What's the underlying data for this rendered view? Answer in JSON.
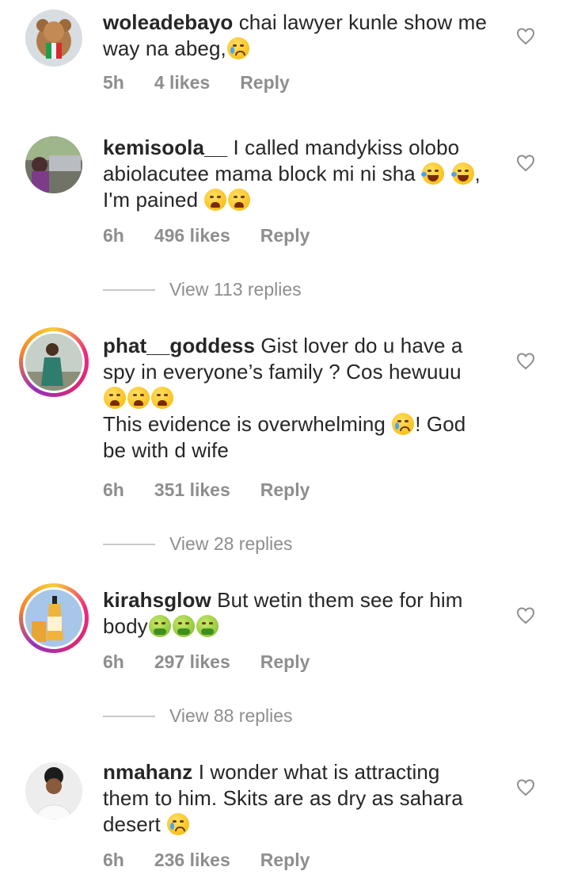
{
  "comments": [
    {
      "username": "woleadebayo",
      "text_parts": [
        "chai lawyer kunle show me way na abeg,"
      ],
      "emoji_end": [
        "crying-face-emoji"
      ],
      "time": "5h",
      "likes": "4 likes",
      "reply": "Reply"
    },
    {
      "username": "kemisoola__",
      "text": "I called mandykiss olobo abiolacutee mama block mi ni sha",
      "text2": ", I'm pained",
      "time": "6h",
      "likes": "496 likes",
      "reply": "Reply",
      "view_replies": "View 113 replies"
    },
    {
      "username": "phat__goddess",
      "text": "Gist lover do u have a spy in everyone’s family ? Cos hewuuu",
      "text2": "This evidence is overwhelming",
      "text3": "! God be with d wife",
      "time": "6h",
      "likes": "351 likes",
      "reply": "Reply",
      "view_replies": "View 28 replies"
    },
    {
      "username": "kirahsglow",
      "text": "But wetin them see for him body",
      "time": "6h",
      "likes": "297 likes",
      "reply": "Reply",
      "view_replies": "View 88 replies"
    },
    {
      "username": "nmahanz",
      "text": "I wonder what is attracting them to him. Skits are as dry as sahara desert",
      "time": "6h",
      "likes": "236 likes",
      "reply": "Reply"
    }
  ],
  "icons": {
    "like": "heart-outline-icon"
  },
  "colors": {
    "meta": "#8e8e8e",
    "text": "#262626"
  }
}
